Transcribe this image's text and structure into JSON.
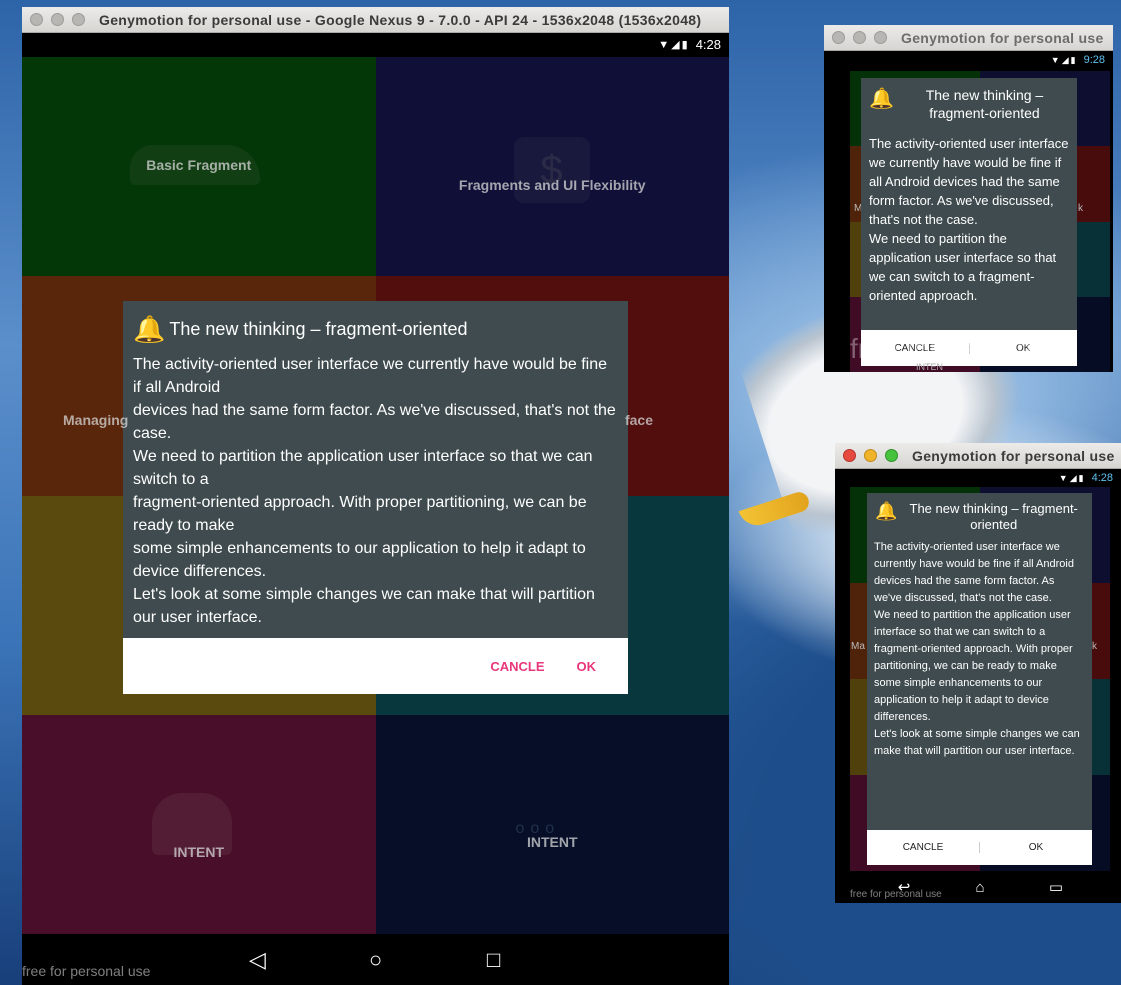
{
  "desktop": {
    "background": "seagull-wallpaper"
  },
  "main_window": {
    "title": "Genymotion for personal use - Google Nexus 9 - 7.0.0 - API 24 - 1536x2048 (1536x2048)",
    "status_time": "4:28",
    "tiles": [
      {
        "label": "Basic Fragment",
        "color": "#0b7a12",
        "icon": "car-icon"
      },
      {
        "label": "Fragments and UI Flexibility",
        "color": "#23237a",
        "icon": "dollar-bag-icon"
      },
      {
        "label": "Managing",
        "color": "#c5561a",
        "icon": ""
      },
      {
        "label": "face",
        "color": "#b51e1e",
        "icon": ""
      },
      {
        "label": "",
        "color": "#c8a41e",
        "icon": ""
      },
      {
        "label": "",
        "color": "#127b8a",
        "icon": ""
      },
      {
        "label": "INTENT",
        "color": "#a0205e",
        "icon": "shopping-person-icon"
      },
      {
        "label": "INTENT",
        "color": "#0f1f5a",
        "icon": "dots-icon"
      }
    ],
    "watermark": "free for personal use",
    "nav": {
      "back": "◁",
      "home": "○",
      "recents": "□"
    }
  },
  "dialog": {
    "title": "The new thinking – fragment-oriented",
    "message": "The activity-oriented user interface we currently have would be fine if all Android\ndevices had the same form factor. As we've discussed, that's not the case.\nWe need to partition the application user interface so that we can switch to a\nfragment-oriented approach. With proper partitioning, we can be ready to make\nsome simple enhancements to our application to help it adapt to device differences.\nLet's look at some simple changes we can make that will partition our user interface.",
    "cancel_label": "CANCLE",
    "ok_label": "OK"
  },
  "small_window": {
    "title": "Genymotion for personal use",
    "status_time": "9:28",
    "dialog_title": "The new thinking – fragment-oriented",
    "message": "The activity-oriented user interface we currently have would be fine if all Android devices had the same form factor. As we've discussed, that's not the case.\nWe need to partition the application user interface so that we can switch to a fragment-oriented approach.",
    "cancel_label": "CANCLE",
    "ok_label": "OK",
    "watermark": "free for personal u",
    "edge_left": "M",
    "edge_right": "k",
    "under_label": "INTEN"
  },
  "mid_window": {
    "title": "Genymotion for personal use",
    "status_time": "4:28",
    "dialog_title": "The new thinking – fragment-oriented",
    "message": "The activity-oriented user interface we currently have would be fine if all Android\ndevices had the same form factor. As we've discussed, that's not the case.\nWe need to partition the application user interface so that we can switch to a\nfragment-oriented approach. With proper partitioning, we can be ready to make\nsome simple enhancements to our application to help it adapt to device differences.\nLet's look at some simple changes we can make that will partition our user interface.",
    "cancel_label": "CANCLE",
    "ok_label": "OK",
    "watermark": "free for personal use",
    "edge_left": "Ma",
    "edge_right": "k",
    "nav": {
      "back": "↩",
      "home": "⌂",
      "recents": "▭"
    }
  }
}
